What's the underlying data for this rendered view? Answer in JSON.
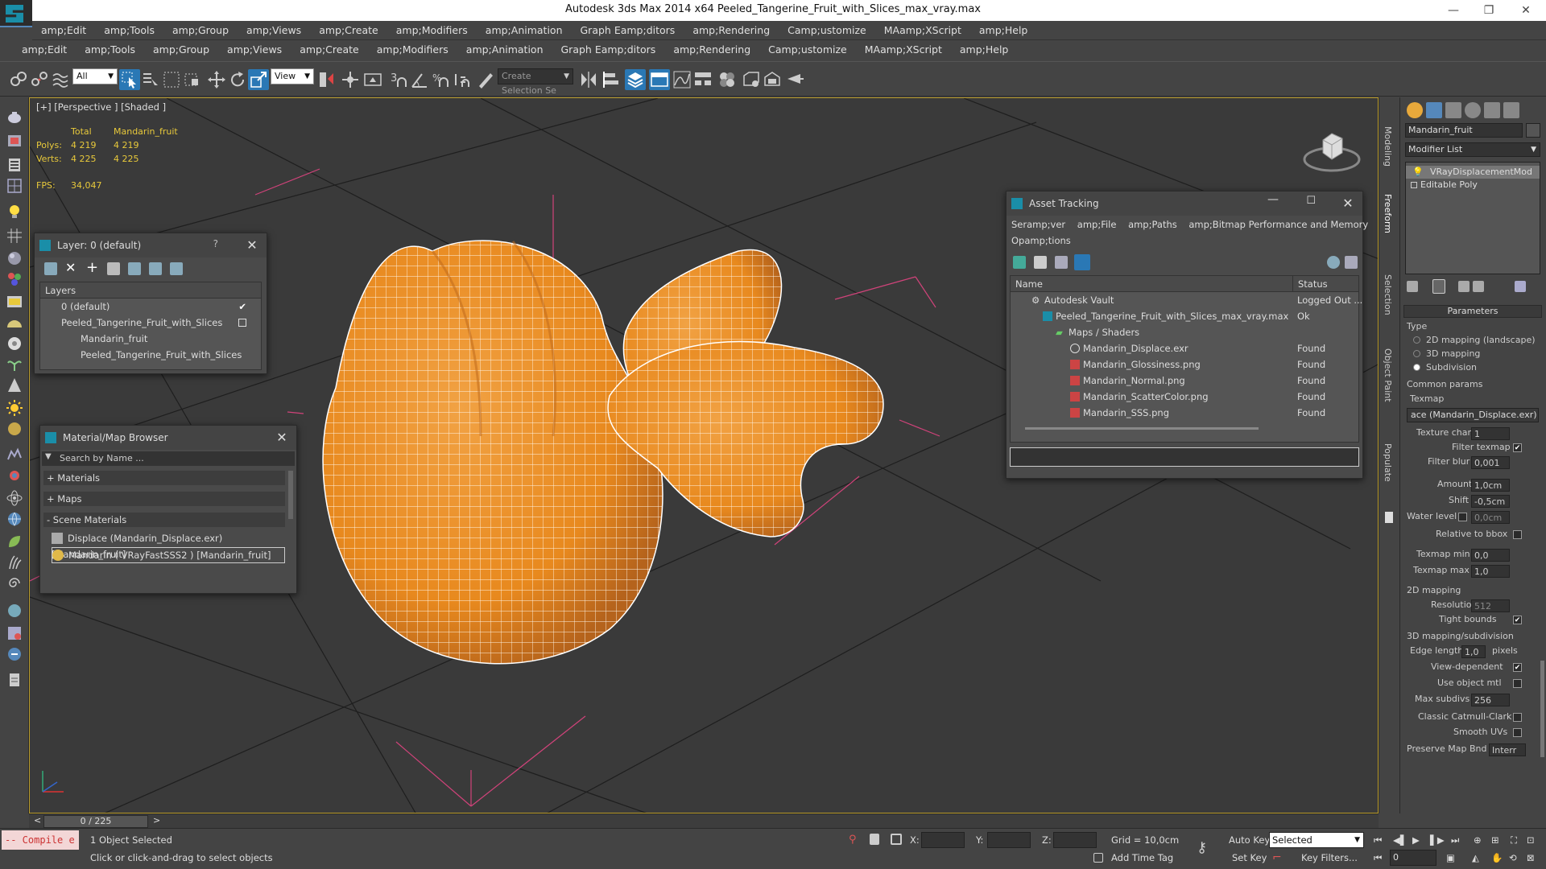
{
  "window": {
    "title": "Autodesk 3ds Max  2014 x64    Peeled_Tangerine_Fruit_with_Slices_max_vray.max",
    "controls": [
      "—",
      "❐",
      "✕"
    ]
  },
  "menu_primary": [
    "amp;Edit",
    "amp;Tools",
    "amp;Group",
    "amp;Views",
    "amp;Create",
    "amp;Modifiers",
    "amp;Animation",
    "Graph Eamp;ditors",
    "amp;Rendering",
    "Camp;ustomize",
    "MAamp;XScript",
    "amp;Help"
  ],
  "menu_secondary": [
    "amp;Edit",
    "amp;Tools",
    "amp;Group",
    "amp;Views",
    "amp;Create",
    "amp;Modifiers",
    "amp;Animation",
    "Graph Eamp;ditors",
    "amp;Rendering",
    "Camp;ustomize",
    "MAamp;XScript",
    "amp;Help"
  ],
  "toolbar": {
    "selection_filter": "All",
    "reference_coord": "View",
    "snap_labels": [
      "3",
      "%"
    ],
    "named_selection_placeholder": "Create Selection Se"
  },
  "viewport": {
    "label": "[+] [Perspective ] [Shaded ]",
    "stats": {
      "col_total": "Total",
      "col_object": "Mandarin_fruit",
      "polys_label": "Polys:",
      "polys_total": "4 219",
      "polys_object": "4 219",
      "verts_label": "Verts:",
      "verts_total": "4 225",
      "verts_object": "4 225",
      "fps_label": "FPS:",
      "fps_value": "34,047"
    }
  },
  "layer_dialog": {
    "title": "Layer: 0 (default)",
    "help": "?",
    "column": "Layers",
    "items": [
      "0 (default)",
      "Peeled_Tangerine_Fruit_with_Slices",
      "Mandarin_fruit",
      "Peeled_Tangerine_Fruit_with_Slices"
    ]
  },
  "material_browser": {
    "title": "Material/Map Browser",
    "search_placeholder": "Search by Name ...",
    "groups": [
      "+ Materials",
      "+ Maps",
      "- Scene Materials"
    ],
    "entries": [
      "Displace (Mandarin_Displace.exr) [Mandarin_fruit]",
      "Mandarin  ( VRayFastSSS2 ) [Mandarin_fruit]"
    ]
  },
  "asset_tracking": {
    "title": "Asset Tracking",
    "menu": [
      "Seramp;ver",
      "amp;File",
      "amp;Paths",
      "amp;Bitmap Performance and Memory"
    ],
    "menu2": "Opamp;tions",
    "col_name": "Name",
    "col_status": "Status",
    "rows": [
      {
        "name": "Autodesk Vault",
        "status": "Logged Out ..."
      },
      {
        "name": "Peeled_Tangerine_Fruit_with_Slices_max_vray.max",
        "status": "Ok"
      },
      {
        "name": "Maps / Shaders",
        "status": ""
      },
      {
        "name": "Mandarin_Displace.exr",
        "status": "Found"
      },
      {
        "name": "Mandarin_Glossiness.png",
        "status": "Found"
      },
      {
        "name": "Mandarin_Normal.png",
        "status": "Found"
      },
      {
        "name": "Mandarin_ScatterColor.png",
        "status": "Found"
      },
      {
        "name": "Mandarin_SSS.png",
        "status": "Found"
      }
    ]
  },
  "right_tabs": [
    "Modeling",
    "Freeform",
    "Selection",
    "Object Paint",
    "Populate"
  ],
  "command_panel": {
    "object_name": "Mandarin_fruit",
    "modifier_list": "Modifier List",
    "stack": [
      "VRayDisplacementMod",
      "Editable Poly"
    ],
    "parameters": "Parameters",
    "type_label": "Type",
    "type_options": [
      "2D mapping (landscape)",
      "3D mapping",
      "Subdivision"
    ],
    "common_params": "Common params",
    "texmap_label": "Texmap",
    "texmap_value": "ace (Mandarin_Displace.exr)",
    "texture_chan_label": "Texture chan",
    "texture_chan": "1",
    "filter_texmap_label": "Filter texmap",
    "filter_blur_label": "Filter blur",
    "filter_blur": "0,001",
    "amount_label": "Amount",
    "amount": "1,0cm",
    "shift_label": "Shift",
    "shift": "-0,5cm",
    "water_level_label": "Water level",
    "water_level": "0,0cm",
    "relative_bbox_label": "Relative to bbox",
    "texmap_min_label": "Texmap min",
    "texmap_min": "0,0",
    "texmap_max_label": "Texmap max",
    "texmap_max": "1,0",
    "mapping2d_label": "2D mapping",
    "resolution_label": "Resolution",
    "resolution": "512",
    "tight_bounds_label": "Tight bounds",
    "mapping3d_label": "3D mapping/subdivision",
    "edge_length_label": "Edge length",
    "edge_length": "1,0",
    "pixels_label": "pixels",
    "view_dependent_label": "View-dependent",
    "use_object_mtl_label": "Use object mtl",
    "max_subdivs_label": "Max subdivs",
    "max_subdivs": "256",
    "classic_catmull_label": "Classic Catmull-Clark",
    "smooth_uvs_label": "Smooth UVs",
    "preserve_map_label": "Preserve Map Bnd",
    "preserve_map_value": "Interr"
  },
  "timeline": {
    "frame": "0 / 225",
    "prev": "<",
    "next": ">"
  },
  "status": {
    "maxscript": "-- Compile e",
    "selected": "1 Object Selected",
    "prompt": "Click or click-and-drag to select objects",
    "x_label": "X:",
    "y_label": "Y:",
    "z_label": "Z:",
    "grid": "Grid = 10,0cm",
    "add_time_tag": "Add Time Tag",
    "auto_key": "Auto Key",
    "set_key": "Set Key",
    "selected_dropdown": "Selected",
    "key_filters": "Key Filters...",
    "frame_field": "0"
  },
  "colors": {
    "accent": "#2a78b5",
    "viewport_border": "#b89a2a",
    "stats": "#e8c93b",
    "fruit": "#e98b2a"
  }
}
